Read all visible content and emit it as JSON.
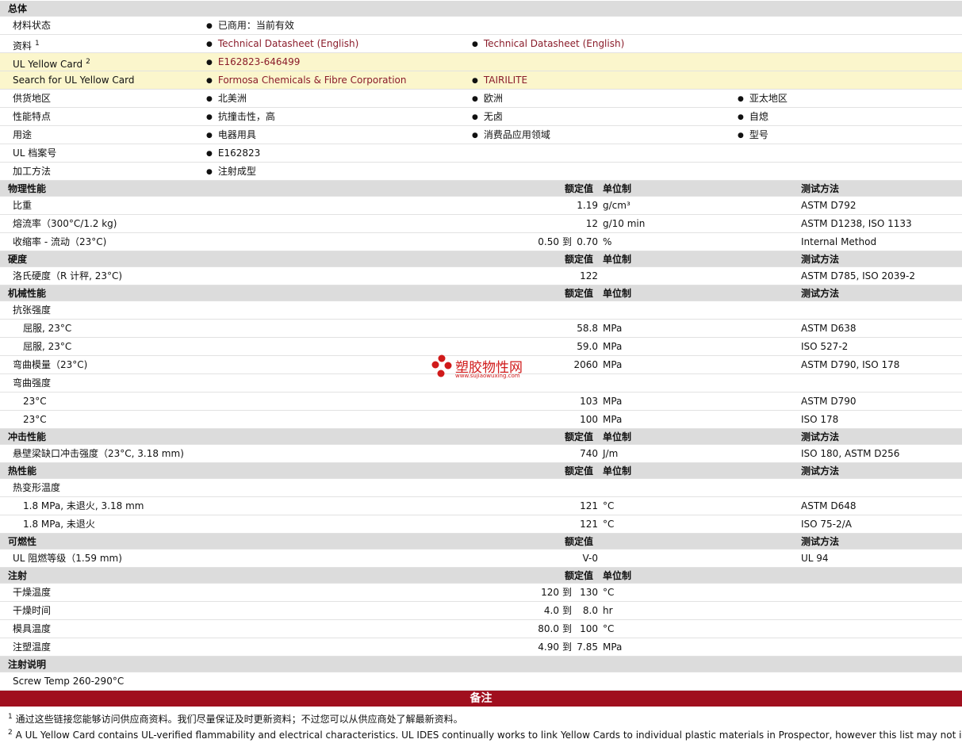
{
  "sections": {
    "general": {
      "title": "总体",
      "rows": [
        {
          "label": "材料状态",
          "values": [
            "已商用：当前有效"
          ]
        },
        {
          "label": "资料",
          "sup": "1",
          "values": [
            "Technical Datasheet (English)",
            "Technical Datasheet (English)"
          ]
        },
        {
          "label": "UL Yellow Card",
          "sup": "2",
          "values": [
            "E162823-646499"
          ]
        },
        {
          "label": "Search for UL Yellow Card",
          "values": [
            "Formosa Chemicals & Fibre Corporation",
            "TAIRILITE"
          ]
        },
        {
          "label": "供货地区",
          "values": [
            "北美洲",
            "欧洲",
            "亚太地区"
          ]
        },
        {
          "label": "性能特点",
          "values": [
            "抗撞击性，高",
            "无卤",
            "自熄"
          ]
        },
        {
          "label": "用途",
          "values": [
            "电器用具",
            "消费品应用领域",
            "型号"
          ]
        },
        {
          "label": "UL 档案号",
          "values": [
            "E162823"
          ]
        },
        {
          "label": "加工方法",
          "values": [
            "注射成型"
          ]
        }
      ]
    },
    "columns": {
      "nominal": "额定值",
      "unit": "单位制",
      "method": "测试方法",
      "to": "到"
    },
    "physical": {
      "title": "物理性能",
      "rows": [
        {
          "label": "比重",
          "value": "1.19",
          "unit": "g/cm³",
          "method": "ASTM D792"
        },
        {
          "label": "熔流率（300°C/1.2 kg)",
          "value": "12",
          "unit": "g/10 min",
          "method": "ASTM D1238, ISO 1133"
        },
        {
          "label": "收缩率 - 流动（23°C)",
          "value_from": "0.50",
          "value_to": "0.70",
          "unit": "%",
          "method": "Internal Method"
        }
      ]
    },
    "hardness": {
      "title": "硬度",
      "rows": [
        {
          "label": "洛氏硬度（R 计秤, 23°C)",
          "value": "122",
          "unit": "",
          "method": "ASTM D785, ISO 2039-2"
        }
      ]
    },
    "mechanical": {
      "title": "机械性能",
      "rows": [
        {
          "label": "抗张强度"
        },
        {
          "label": "屈服, 23°C",
          "sub": true,
          "value": "58.8",
          "unit": "MPa",
          "method": "ASTM D638"
        },
        {
          "label": "屈服, 23°C",
          "sub": true,
          "value": "59.0",
          "unit": "MPa",
          "method": "ISO 527-2"
        },
        {
          "label": "弯曲模量（23°C)",
          "value": "2060",
          "unit": "MPa",
          "method": "ASTM D790, ISO 178"
        },
        {
          "label": "弯曲强度"
        },
        {
          "label": "23°C",
          "sub": true,
          "value": "103",
          "unit": "MPa",
          "method": "ASTM D790"
        },
        {
          "label": "23°C",
          "sub": true,
          "value": "100",
          "unit": "MPa",
          "method": "ISO 178"
        }
      ]
    },
    "impact": {
      "title": "冲击性能",
      "rows": [
        {
          "label": "悬壁梁缺口冲击强度（23°C, 3.18 mm)",
          "value": "740",
          "unit": "J/m",
          "method": "ISO 180, ASTM D256"
        }
      ]
    },
    "thermal": {
      "title": "热性能",
      "rows": [
        {
          "label": "热变形温度"
        },
        {
          "label": "1.8 MPa, 未退火, 3.18 mm",
          "sub": true,
          "value": "121",
          "unit": "°C",
          "method": "ASTM D648"
        },
        {
          "label": "1.8 MPa, 未退火",
          "sub": true,
          "value": "121",
          "unit": "°C",
          "method": "ISO 75-2/A"
        }
      ]
    },
    "flammability": {
      "title": "可燃性",
      "rows": [
        {
          "label": "UL 阻燃等级（1.59 mm)",
          "value": "V-0",
          "unit": "",
          "method": "UL 94"
        }
      ]
    },
    "injection": {
      "title": "注射",
      "rows": [
        {
          "label": "干燥温度",
          "value_from": "120",
          "value_to": "130",
          "unit": "°C"
        },
        {
          "label": "干燥时间",
          "value_from": "4.0",
          "value_to": "8.0",
          "unit": "hr"
        },
        {
          "label": "模具温度",
          "value_from": "80.0",
          "value_to": "100",
          "unit": "°C"
        },
        {
          "label": "注塑温度",
          "value_from": "4.90",
          "value_to": "7.85",
          "unit": "MPa"
        }
      ]
    },
    "injection_notes": {
      "title": "注射说明",
      "rows": [
        {
          "label": "Screw Temp 260-290°C"
        }
      ]
    }
  },
  "notes": {
    "title": "备注",
    "items": [
      {
        "num": "1",
        "text": "通过这些链接您能够访问供应商资料。我们尽量保证及时更新资料；不过您可以从供应商处了解最新资料。"
      },
      {
        "num": "2",
        "text": "A UL Yellow Card contains UL-verified flammability and electrical characteristics. UL IDES continually works to link Yellow Cards to individual plastic materials in Prospector, however this list may not include"
      }
    ]
  },
  "watermark": {
    "name": "塑胶物性网",
    "url": "www.sujiaowuxing.com",
    "color": "#d01a1a"
  },
  "colors": {
    "header": "#dcdcdc",
    "yellow": "#fbf6cc",
    "link": "#8a1c2a",
    "banner": "#a00f1e"
  }
}
